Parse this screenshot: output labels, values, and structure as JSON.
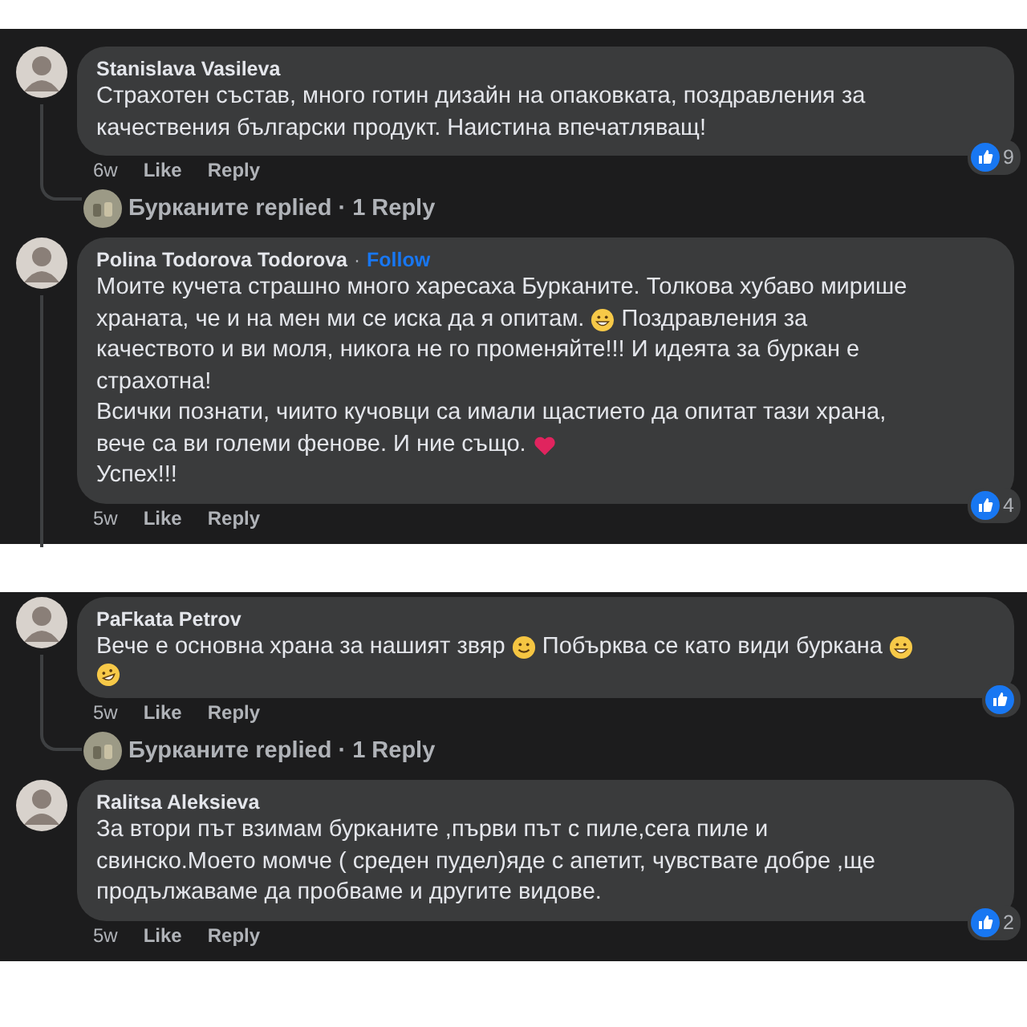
{
  "panels": [
    {
      "comments": [
        {
          "author": "Stanislava Vasileva",
          "lines": [
            [
              {
                "kind": "text",
                "text": "Страхотен състав, много готин дизайн на опаковката, поздравления за"
              }
            ],
            [
              {
                "kind": "text",
                "text": "качествения български продукт. Наистина впечатляващ!"
              }
            ]
          ],
          "time": "6w",
          "actions": [
            "Like",
            "Reply"
          ],
          "reaction_count": "9",
          "thread": true,
          "reply_summary": "Бурканите replied · 1 Reply"
        },
        {
          "author": "Polina Todorova Todorova",
          "follow_separator": "·",
          "follow_label": "Follow",
          "lines": [
            [
              {
                "kind": "text",
                "text": "Моите кучета страшно много харесаха Бурканите. Толкова хубаво мирише"
              }
            ],
            [
              {
                "kind": "text",
                "text": "храната, че и на мен ми се иска да я опитам. "
              },
              {
                "kind": "grin"
              },
              {
                "kind": "text",
                "text": " Поздравления за"
              }
            ],
            [
              {
                "kind": "text",
                "text": "качеството и ви моля, никога не го променяйте!!! И идеята за буркан е"
              }
            ],
            [
              {
                "kind": "text",
                "text": "страхотна!"
              }
            ],
            [
              {
                "kind": "text",
                "text": "Всички познати, чиито кучовци са имали щастието да опитат тази храна,"
              }
            ],
            [
              {
                "kind": "text",
                "text": "вече са ви големи фенове. И ние също. "
              },
              {
                "kind": "heart"
              }
            ],
            [
              {
                "kind": "text",
                "text": "Успех!!!"
              }
            ]
          ],
          "time": "5w",
          "actions": [
            "Like",
            "Reply"
          ],
          "reaction_count": "4",
          "thread": true
        }
      ]
    },
    {
      "comments": [
        {
          "author": "PaFkata Petrov",
          "lines": [
            [
              {
                "kind": "text",
                "text": "Вече е основна храна за нашият звяр "
              },
              {
                "kind": "smile"
              },
              {
                "kind": "text",
                "text": " Побърква се като види буркана "
              },
              {
                "kind": "grin"
              }
            ],
            [
              {
                "kind": "laugh"
              }
            ]
          ],
          "time": "5w",
          "actions": [
            "Like",
            "Reply"
          ],
          "thread": true,
          "reply_summary": "Бурканите replied · 1 Reply"
        },
        {
          "author": "Ralitsa Aleksieva",
          "lines": [
            [
              {
                "kind": "text",
                "text": "За втори път взимам бурканите ,първи път с пиле,сега пиле и"
              }
            ],
            [
              {
                "kind": "text",
                "text": "свинско.Моето момче ( среден пудел)яде с апетит, чувствате добре ,ще"
              }
            ],
            [
              {
                "kind": "text",
                "text": "продължаваме да пробваме и другите видове."
              }
            ]
          ],
          "time": "5w",
          "actions": [
            "Like",
            "Reply"
          ],
          "reaction_count": "2",
          "thread": false
        }
      ]
    }
  ]
}
